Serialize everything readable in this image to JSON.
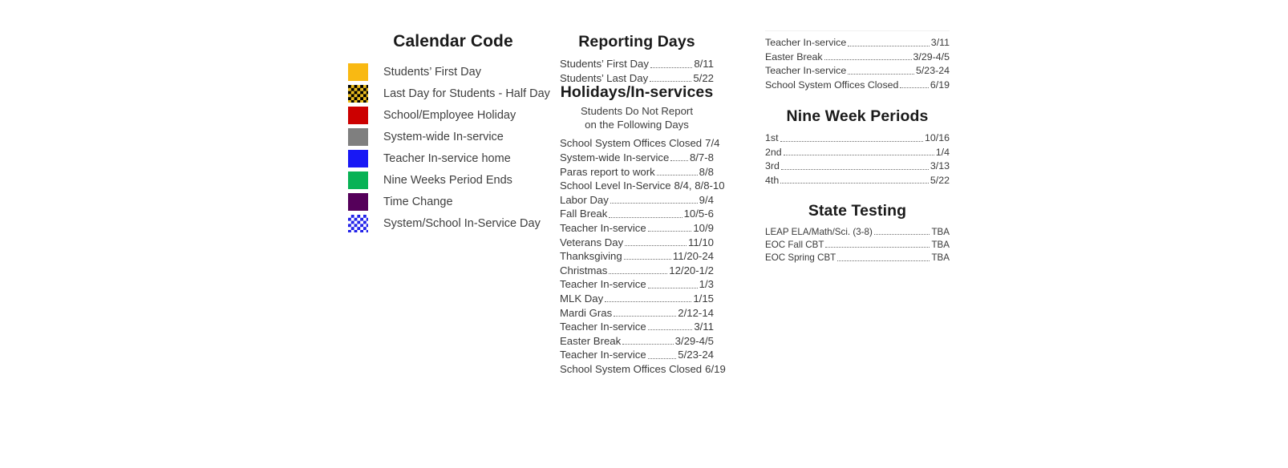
{
  "calendar_code": {
    "title": "Calendar Code",
    "items": [
      {
        "label": "Students’ First Day",
        "swatch": "solid",
        "color": "#f9b912",
        "icon_name": "swatch-students-first-day"
      },
      {
        "label": "Last Day for Students - Half Day",
        "swatch": "check-gold",
        "color": "#f7c620",
        "icon_name": "swatch-last-day-half-day"
      },
      {
        "label": "School/Employee Holiday",
        "swatch": "solid",
        "color": "#cc0000",
        "icon_name": "swatch-school-employee-holiday"
      },
      {
        "label": "System-wide In-service",
        "swatch": "solid",
        "color": "#7f7f7f",
        "icon_name": "swatch-system-wide-inservice"
      },
      {
        "label": "Teacher In-service home",
        "swatch": "solid",
        "color": "#1818f5",
        "icon_name": "swatch-teacher-inservice-home"
      },
      {
        "label": "Nine Weeks Period Ends",
        "swatch": "solid",
        "color": "#08b255",
        "icon_name": "swatch-nine-weeks-period-ends"
      },
      {
        "label": "Time Change",
        "swatch": "solid",
        "color": "#55005a",
        "icon_name": "swatch-time-change"
      },
      {
        "label": "System/School In-Service Day",
        "swatch": "check-blue",
        "color": "#1818e8",
        "icon_name": "swatch-system-school-inservice-day"
      }
    ]
  },
  "reporting_days": {
    "title": "Reporting Days",
    "rows": [
      {
        "label": "Students’ First Day",
        "value": "8/11"
      },
      {
        "label": "Students’ Last Day",
        "value": "5/22"
      }
    ]
  },
  "holidays": {
    "title": "Holidays/In-services",
    "note_line1": "Students Do Not Report",
    "note_line2": "on the Following Days",
    "rows": [
      {
        "label": "School System Offices Closed",
        "value": "7/4"
      },
      {
        "label": "System-wide In-service",
        "value": "8/7-8"
      },
      {
        "label": "Paras report to work",
        "value": "8/8"
      },
      {
        "label": "School Level In-Service",
        "value": "8/4, 8/8-10"
      },
      {
        "label": "Labor Day",
        "value": "9/4"
      },
      {
        "label": "Fall Break",
        "value": "10/5-6"
      },
      {
        "label": "Teacher In-service",
        "value": "10/9"
      },
      {
        "label": "Veterans Day",
        "value": "11/10"
      },
      {
        "label": "Thanksgiving",
        "value": "11/20-24"
      },
      {
        "label": "Christmas",
        "value": "12/20-1/2"
      },
      {
        "label": "Teacher In-service",
        "value": "1/3"
      },
      {
        "label": "MLK Day",
        "value": "1/15"
      },
      {
        "label": "Mardi Gras",
        "value": "2/12-14"
      },
      {
        "label": "Teacher In-service",
        "value": "3/11"
      },
      {
        "label": "Easter Break",
        "value": "3/29-4/5"
      },
      {
        "label": "Teacher In-service",
        "value": "5/23-24"
      },
      {
        "label": "School System Offices Closed",
        "value": "6/19"
      }
    ]
  },
  "holidays_continued": {
    "rows": [
      {
        "label": "Teacher In-service",
        "value": "3/11"
      },
      {
        "label": "Easter Break",
        "value": "3/29-4/5"
      },
      {
        "label": "Teacher In-service",
        "value": "5/23-24"
      },
      {
        "label": "School System Offices Closed",
        "value": "6/19"
      }
    ]
  },
  "nine_week_periods": {
    "title": "Nine Week Periods",
    "rows": [
      {
        "label": "1st",
        "value": "10/16"
      },
      {
        "label": "2nd",
        "value": "1/4"
      },
      {
        "label": "3rd",
        "value": "3/13"
      },
      {
        "label": "4th",
        "value": "5/22"
      }
    ]
  },
  "state_testing": {
    "title": "State Testing",
    "rows": [
      {
        "label": "LEAP ELA/Math/Sci. (3-8)",
        "value": "TBA"
      },
      {
        "label": "EOC Fall CBT",
        "value": "TBA"
      },
      {
        "label": "EOC Spring CBT",
        "value": "TBA"
      }
    ]
  }
}
